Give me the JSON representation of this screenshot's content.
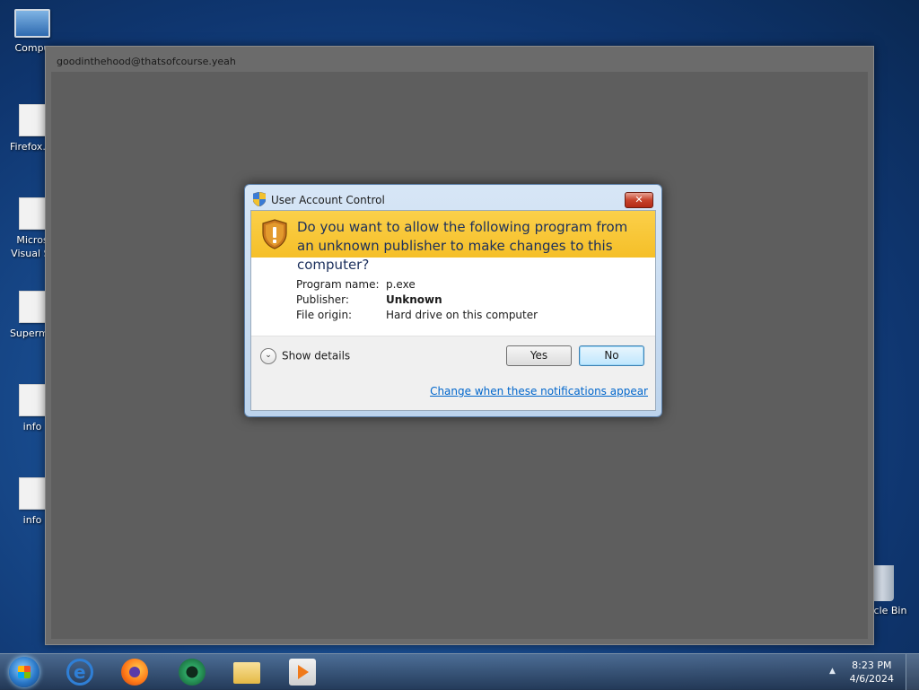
{
  "desktop": {
    "icons": [
      {
        "label": "Compu",
        "icon": "computer-icon"
      },
      {
        "label": "Firefox.In",
        "icon": "file-icon"
      },
      {
        "label": "Micros",
        "label2": "Visual St",
        "icon": "file-icon"
      },
      {
        "label": "Supermit",
        "icon": "file-icon"
      },
      {
        "label": "info",
        "icon": "file-icon"
      },
      {
        "label": "info",
        "icon": "file-icon"
      }
    ],
    "recycle_bin_label": "cle Bin"
  },
  "background_window": {
    "title": "goodinthehood@thatsofcourse.yeah"
  },
  "uac_dialog": {
    "title": "User Account Control",
    "close_label": "✕",
    "question": "Do you want to allow the following program from an unknown publisher to make changes to this computer?",
    "fields": {
      "program_name_label": "Program name:",
      "program_name_value": "p.exe",
      "publisher_label": "Publisher:",
      "publisher_value": "Unknown",
      "file_origin_label": "File origin:",
      "file_origin_value": "Hard drive on this computer"
    },
    "show_details_label": "Show details",
    "yes_label": "Yes",
    "no_label": "No",
    "notification_link": "Change when these notifications appear",
    "banner_color": "#f9c93a"
  },
  "taskbar": {
    "items": [
      "start-button",
      "internet-explorer-icon",
      "firefox-icon",
      "disc-app-icon",
      "file-explorer-icon",
      "media-player-icon"
    ],
    "tray_arrow": "▲",
    "time": "8:23 PM",
    "date": "4/6/2024"
  }
}
